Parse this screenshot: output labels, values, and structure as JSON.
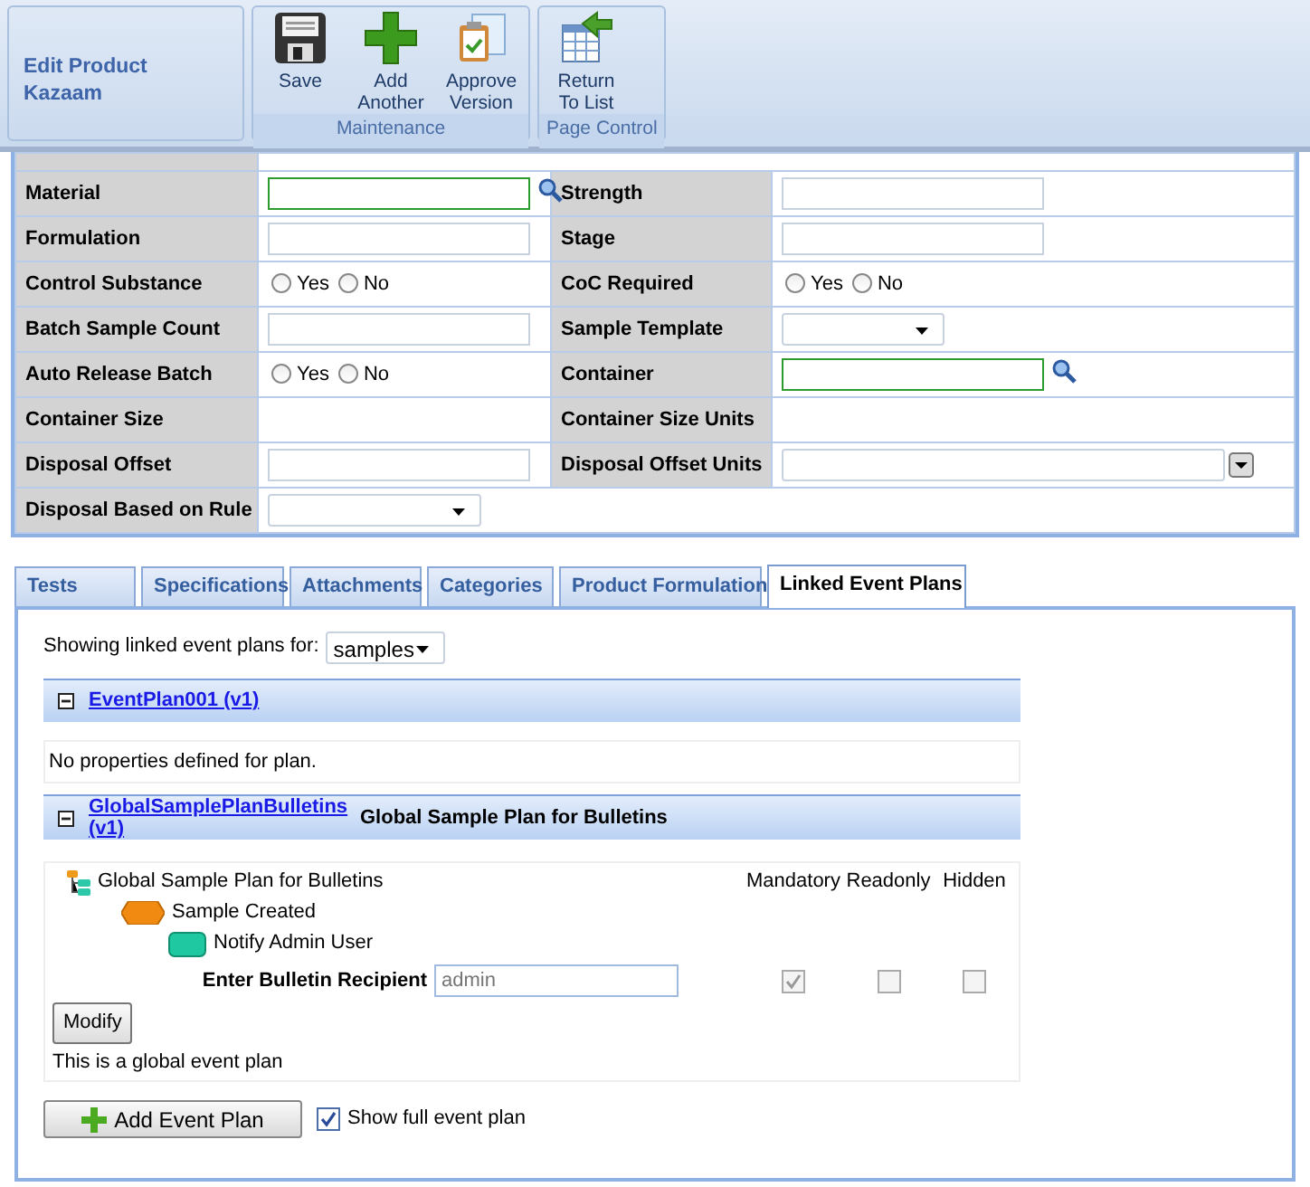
{
  "ribbon": {
    "title": "Edit Product",
    "subtitle": "Kazaam",
    "groups": [
      {
        "label": "Maintenance",
        "buttons": [
          {
            "kind": "save",
            "lines": [
              "Save"
            ]
          },
          {
            "kind": "add",
            "lines": [
              "Add",
              "Another"
            ]
          },
          {
            "kind": "approve",
            "lines": [
              "Approve",
              "Version"
            ]
          }
        ]
      },
      {
        "label": "Page Control",
        "buttons": [
          {
            "kind": "return",
            "lines": [
              "Return",
              "To List"
            ]
          }
        ]
      }
    ]
  },
  "form": {
    "rows": [
      [
        {
          "label": "Material",
          "kind": "lookup"
        },
        {
          "label": "Strength",
          "kind": "text"
        }
      ],
      [
        {
          "label": "Formulation",
          "kind": "text"
        },
        {
          "label": "Stage",
          "kind": "text"
        }
      ],
      [
        {
          "label": "Control Substance",
          "kind": "radio",
          "options": [
            {
              "label": "Yes",
              "selected": false
            },
            {
              "label": "No",
              "selected": false
            }
          ]
        },
        {
          "label": "CoC Required",
          "kind": "radio",
          "options": [
            {
              "label": "Yes",
              "selected": false
            },
            {
              "label": "No",
              "selected": false
            }
          ]
        }
      ],
      [
        {
          "label": "Batch Sample Count",
          "kind": "text"
        },
        {
          "label": "Sample Template",
          "kind": "select"
        }
      ],
      [
        {
          "label": "Auto Release Batch",
          "kind": "radio",
          "options": [
            {
              "label": "Yes",
              "selected": false
            },
            {
              "label": "No",
              "selected": false
            }
          ]
        },
        {
          "label": "Container",
          "kind": "lookup"
        }
      ],
      [
        {
          "label": "Container Size",
          "kind": "static"
        },
        {
          "label": "Container Size Units",
          "kind": "static"
        }
      ],
      [
        {
          "label": "Disposal Offset",
          "kind": "text"
        },
        {
          "label": "Disposal Offset Units",
          "kind": "combo"
        }
      ],
      [
        {
          "label": "Disposal Based on Rule",
          "kind": "select"
        }
      ]
    ]
  },
  "tabs": [
    {
      "label": "Tests",
      "selected": false
    },
    {
      "label": "Specifications",
      "selected": false
    },
    {
      "label": "Attachments",
      "selected": false
    },
    {
      "label": "Categories",
      "selected": false
    },
    {
      "label": "Product Formulation",
      "selected": false
    },
    {
      "label": "Linked Event Plans",
      "selected": true
    }
  ],
  "linked_plans": {
    "filter_label": "Showing linked event plans for:",
    "filter_value": "samples",
    "plans": [
      {
        "link": "EventPlan001 (v1)",
        "expanded": true,
        "body": {
          "kind": "message",
          "text": "No properties defined for plan."
        }
      },
      {
        "link": "GlobalSamplePlanBulletins (v1)",
        "description": "Global Sample Plan for Bulletins",
        "expanded": true,
        "body": {
          "kind": "tree",
          "columns": [
            "Mandatory",
            "Readonly",
            "Hidden"
          ],
          "tree": [
            {
              "label": "Global Sample Plan for Bulletins",
              "kind": "plan",
              "children": [
                {
                  "label": "Sample Created",
                  "kind": "event",
                  "children": [
                    {
                      "label": "Notify Admin User",
                      "kind": "action"
                    }
                  ]
                }
              ]
            }
          ],
          "properties": [
            {
              "label": "Enter Bulletin Recipient",
              "placeholder": "admin",
              "checks": [
                {
                  "checked": true,
                  "disabled": true
                },
                {
                  "checked": false,
                  "disabled": true
                },
                {
                  "checked": false,
                  "disabled": true
                }
              ]
            }
          ],
          "button": "Modify",
          "note": "This is a global event plan"
        }
      }
    ],
    "add_button": "Add Event Plan",
    "show_full": {
      "label": "Show full event plan",
      "checked": true
    }
  }
}
